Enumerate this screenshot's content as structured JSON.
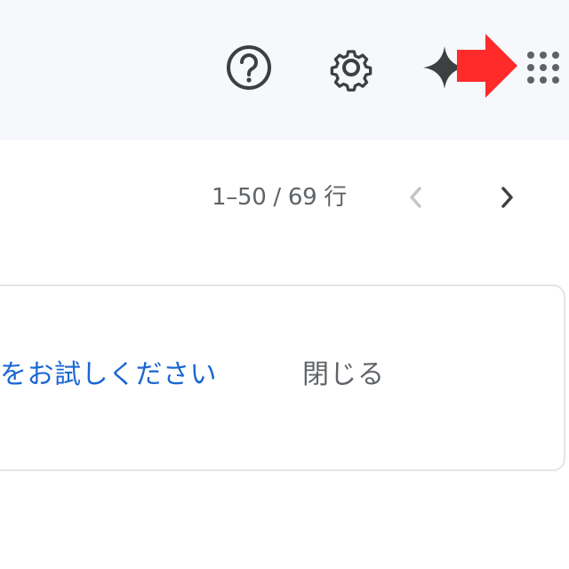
{
  "header": {
    "icons": [
      "help-icon",
      "settings-icon",
      "gemini-icon",
      "apps-grid-icon"
    ],
    "annotation_color": "#ff2a2a"
  },
  "pager": {
    "range_text": "1–50 / 69 行",
    "prev_icon": "chevron-left-icon",
    "next_icon": "chevron-right-icon"
  },
  "promo": {
    "link_text": "をお試しください",
    "close_label": "閉じる"
  },
  "colors": {
    "topbar_bg": "#f6f8fc",
    "link_blue": "#1a67d2",
    "text_gray": "#5f6368",
    "icon_dark": "#3c4043"
  }
}
